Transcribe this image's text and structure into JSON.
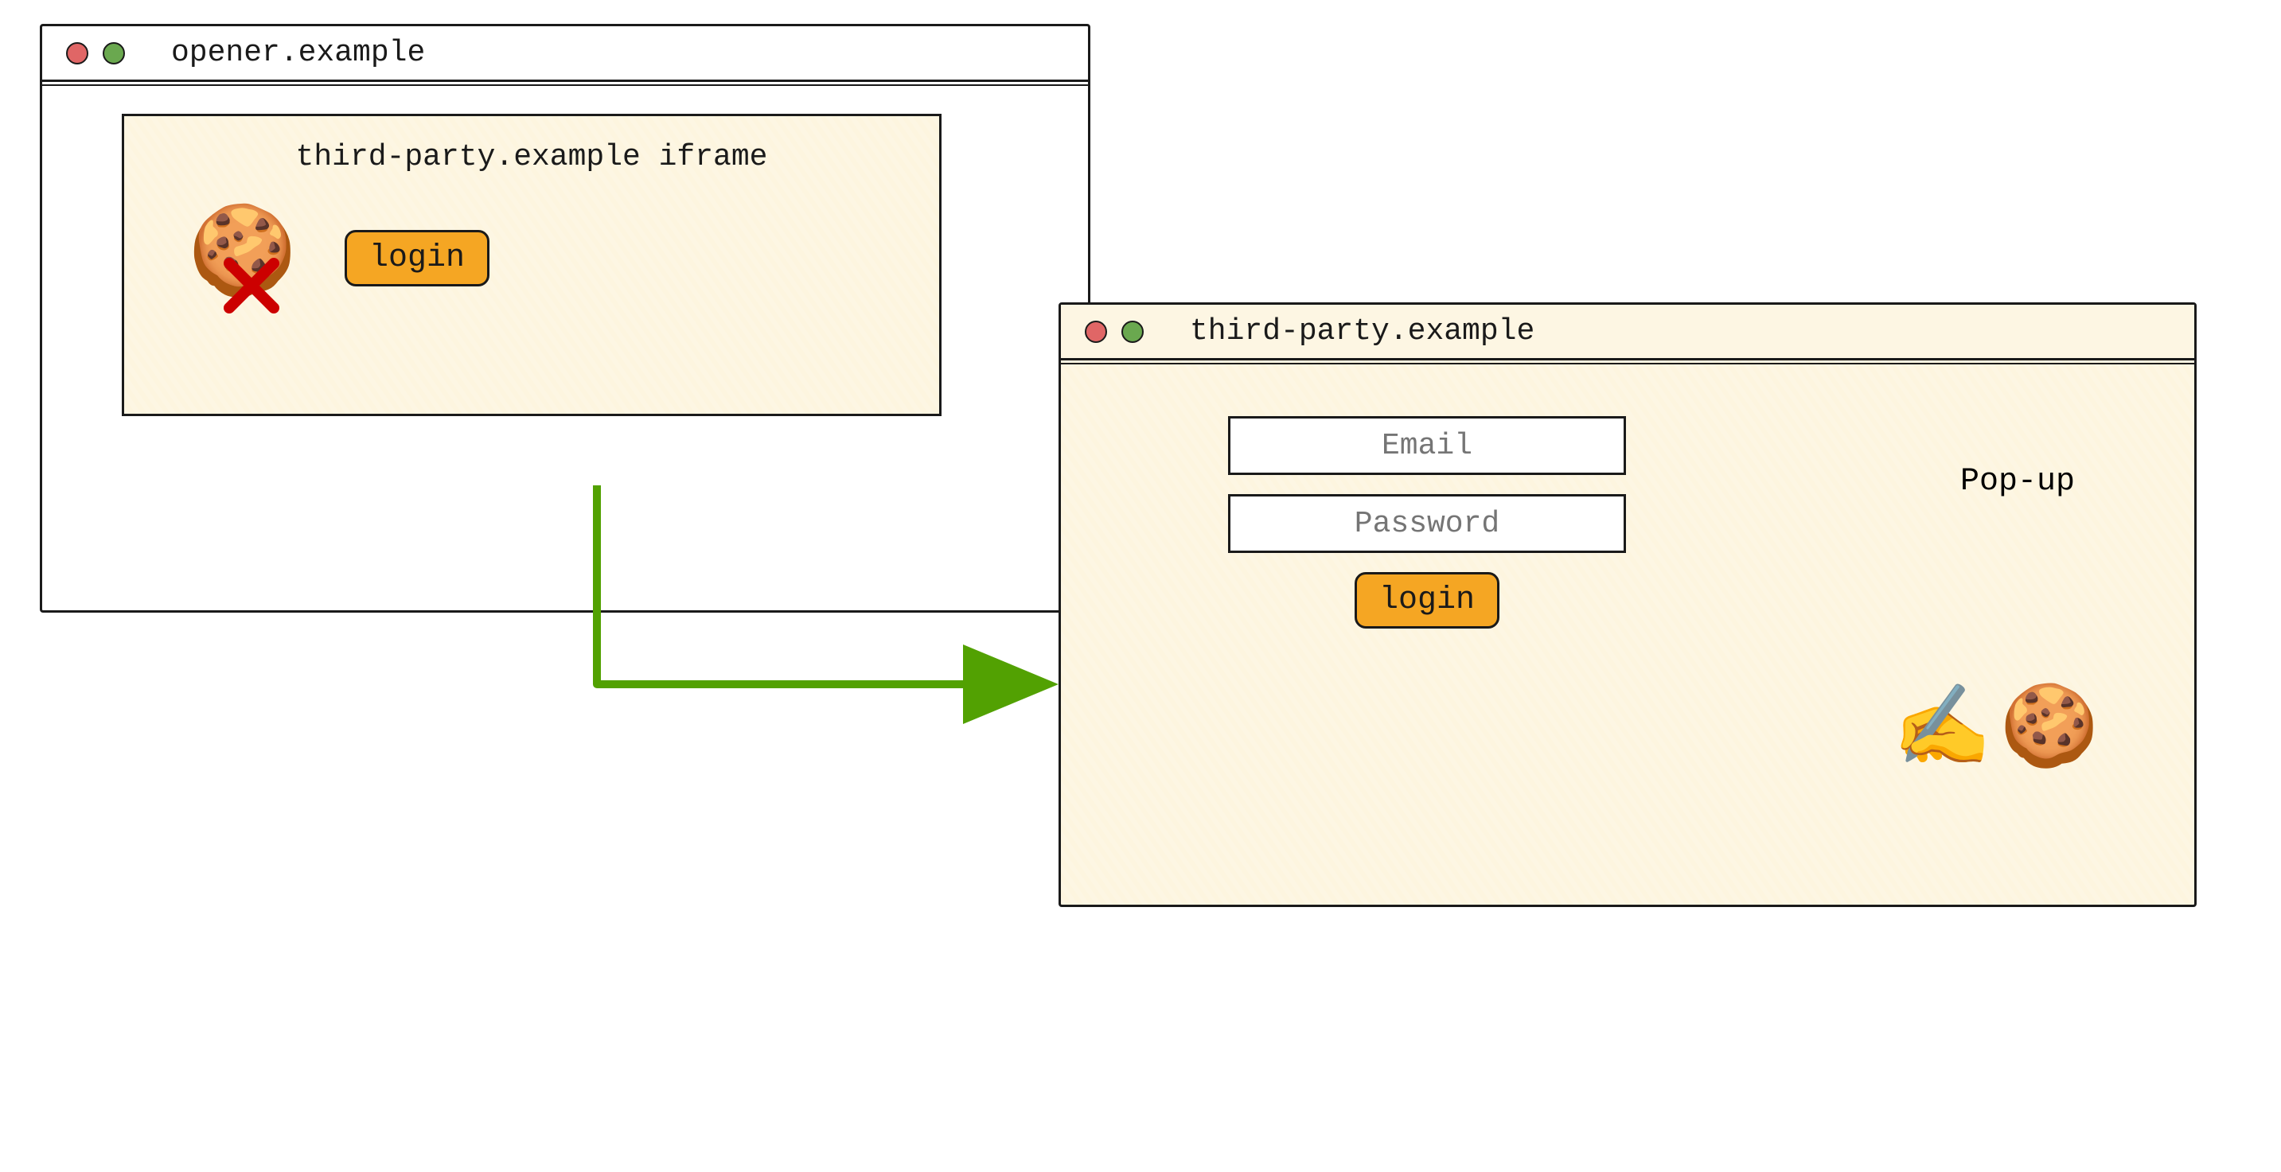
{
  "opener": {
    "title": "opener.example",
    "iframe": {
      "title": "third-party.example iframe",
      "login_label": "login",
      "cookie_icon": "🍪",
      "blocked_icon": "❌"
    }
  },
  "popup": {
    "title": "third-party.example",
    "label": "Pop-up",
    "email_placeholder": "Email",
    "password_placeholder": "Password",
    "login_label": "login",
    "writing_icon": "✍️",
    "cookie_icon": "🍪"
  },
  "colors": {
    "accent": "#f5a623",
    "arrow": "#6aa84f",
    "red_dot": "#e06666",
    "green_dot": "#6aa84f"
  }
}
